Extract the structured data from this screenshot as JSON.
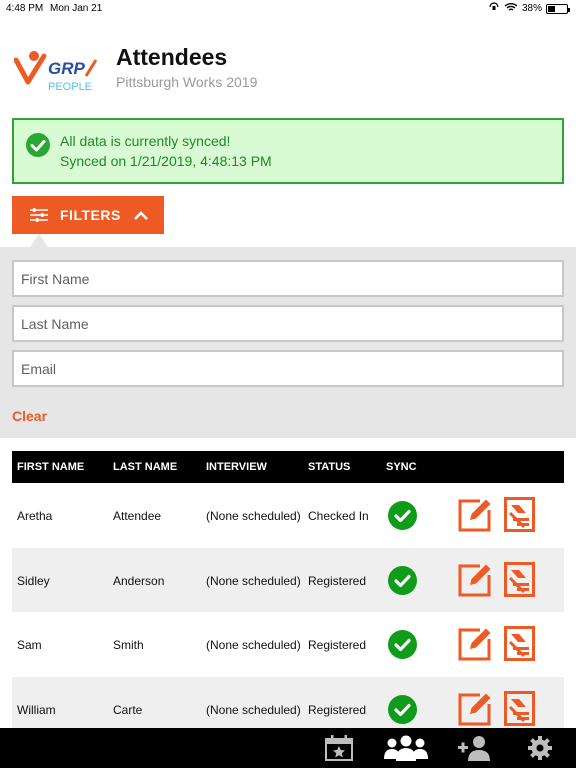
{
  "status_bar": {
    "time": "4:48 PM",
    "date": "Mon Jan 21",
    "battery": "38%",
    "battery_level": 0.38
  },
  "header": {
    "title": "Attendees",
    "subtitle": "Pittsburgh Works 2019",
    "logo": {
      "text_top": "GRP",
      "text_bottom": "PEOPLE",
      "colors": [
        "#ee5a24",
        "#2a4fa0",
        "#4fc3e8"
      ]
    }
  },
  "sync_banner": {
    "line1": "All data is currently synced!",
    "line2": "Synced on 1/21/2019, 4:48:13 PM",
    "icon": "check-circle-icon",
    "color": "#2aa634",
    "background": "#d9fbd3"
  },
  "filters": {
    "button_label": "FILTERS",
    "icon": "sliders-icon",
    "expanded": true,
    "fields": [
      {
        "name": "first-name",
        "placeholder": "First Name",
        "value": ""
      },
      {
        "name": "last-name",
        "placeholder": "Last Name",
        "value": ""
      },
      {
        "name": "email",
        "placeholder": "Email",
        "value": ""
      }
    ],
    "clear_label": "Clear"
  },
  "table": {
    "columns": [
      "FIRST NAME",
      "LAST NAME",
      "INTERVIEW",
      "STATUS",
      "SYNC"
    ],
    "rows": [
      {
        "first_name": "Aretha",
        "last_name": "Attendee",
        "interview": "(None scheduled)",
        "status": "Checked In",
        "synced": true
      },
      {
        "first_name": "Sidley",
        "last_name": "Anderson",
        "interview": "(None scheduled)",
        "status": "Registered",
        "synced": true
      },
      {
        "first_name": "Sam",
        "last_name": "Smith",
        "interview": "(None scheduled)",
        "status": "Registered",
        "synced": true
      },
      {
        "first_name": "William",
        "last_name": "Carte",
        "interview": "(None scheduled)",
        "status": "Registered",
        "synced": true
      }
    ],
    "row_actions": [
      "edit-icon",
      "check-in-icon"
    ]
  },
  "tab_bar": {
    "tabs": [
      {
        "name": "events",
        "icon": "calendar-star-icon",
        "active": false
      },
      {
        "name": "attendees",
        "icon": "people-icon",
        "active": true
      },
      {
        "name": "add-attendee",
        "icon": "add-person-icon",
        "active": false
      },
      {
        "name": "settings",
        "icon": "gear-icon",
        "active": false
      }
    ]
  },
  "colors": {
    "accent": "#ee5a24",
    "success": "#0f9c1a",
    "tab_bar": "#000000"
  }
}
